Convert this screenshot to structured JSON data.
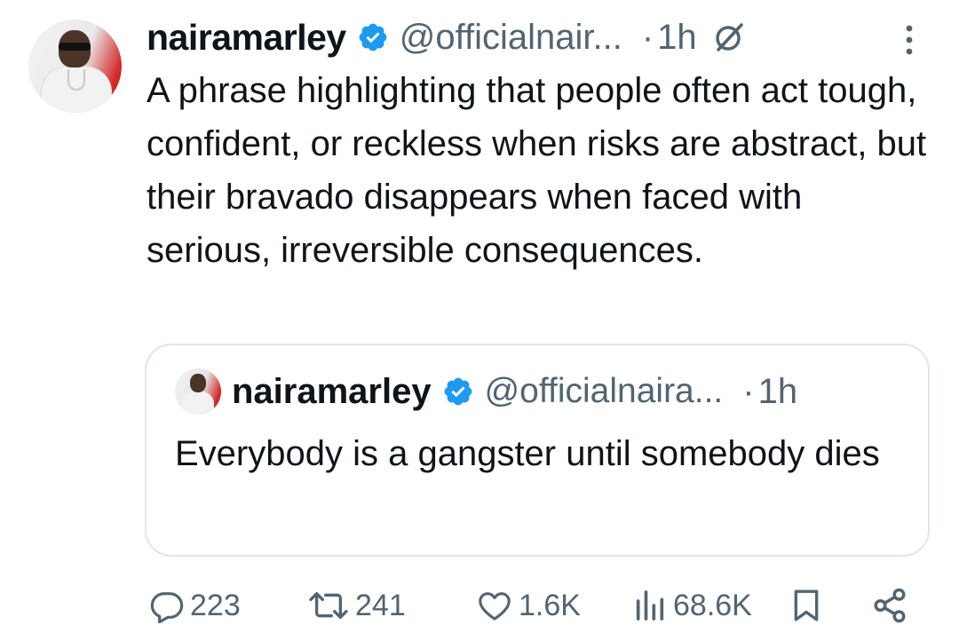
{
  "tweet": {
    "author_name": "nairamarley",
    "handle": "@officialnair...",
    "separator": "·",
    "time": "1h",
    "text": "A phrase highlighting that people often act tough, confident, or reckless when risks are abstract, but their bravado disappears when faced with serious, irreversible consequences."
  },
  "quoted_tweet": {
    "author_name": "nairamarley",
    "handle": "@officialnaira...",
    "separator": "·",
    "time": "1h",
    "text": "Everybody is a gangster until somebody dies"
  },
  "actions": {
    "replies": "223",
    "reposts": "241",
    "likes": "1.6K",
    "views": "68.6K"
  },
  "icons": {
    "verified": "verified-badge-icon",
    "grok": "grok-icon",
    "more": "more-options-icon",
    "reply": "reply-icon",
    "repost": "repost-icon",
    "like": "like-icon",
    "views": "views-icon",
    "bookmark": "bookmark-icon",
    "share": "share-icon"
  },
  "colors": {
    "verified_blue": "#1d9bf0",
    "secondary_text": "#536471",
    "primary_text": "#0f1419",
    "border": "#e1e6ea"
  }
}
